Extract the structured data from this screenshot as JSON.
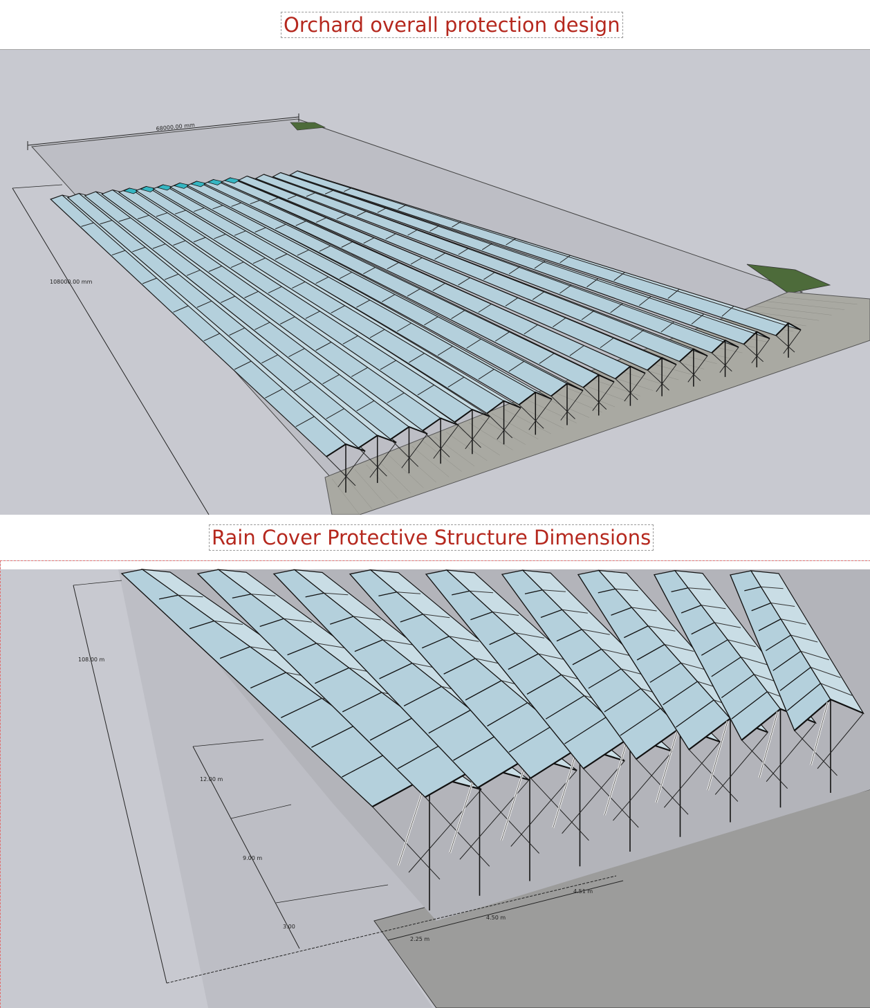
{
  "titles": {
    "top": "Orchard overall protection design",
    "bottom": "Rain Cover Protective Structure Dimensions"
  },
  "overview": {
    "width_label": "68000.00 mm",
    "length_label": "108000.00 mm",
    "rows": 15
  },
  "detail": {
    "length_label": "108.00 m",
    "spacing_labels": [
      "12.00 m",
      "9.00 m",
      "3.00"
    ],
    "bay_labels": [
      "4.51 m",
      "4.50 m",
      "2.25 m"
    ]
  },
  "colors": {
    "background": "#c8c9d0",
    "film": "#b4d0dc",
    "accent_row": "#35b6c2",
    "grass": "#4d6b3a",
    "pavement": "#a9a9a2",
    "title": "#b5281e"
  }
}
